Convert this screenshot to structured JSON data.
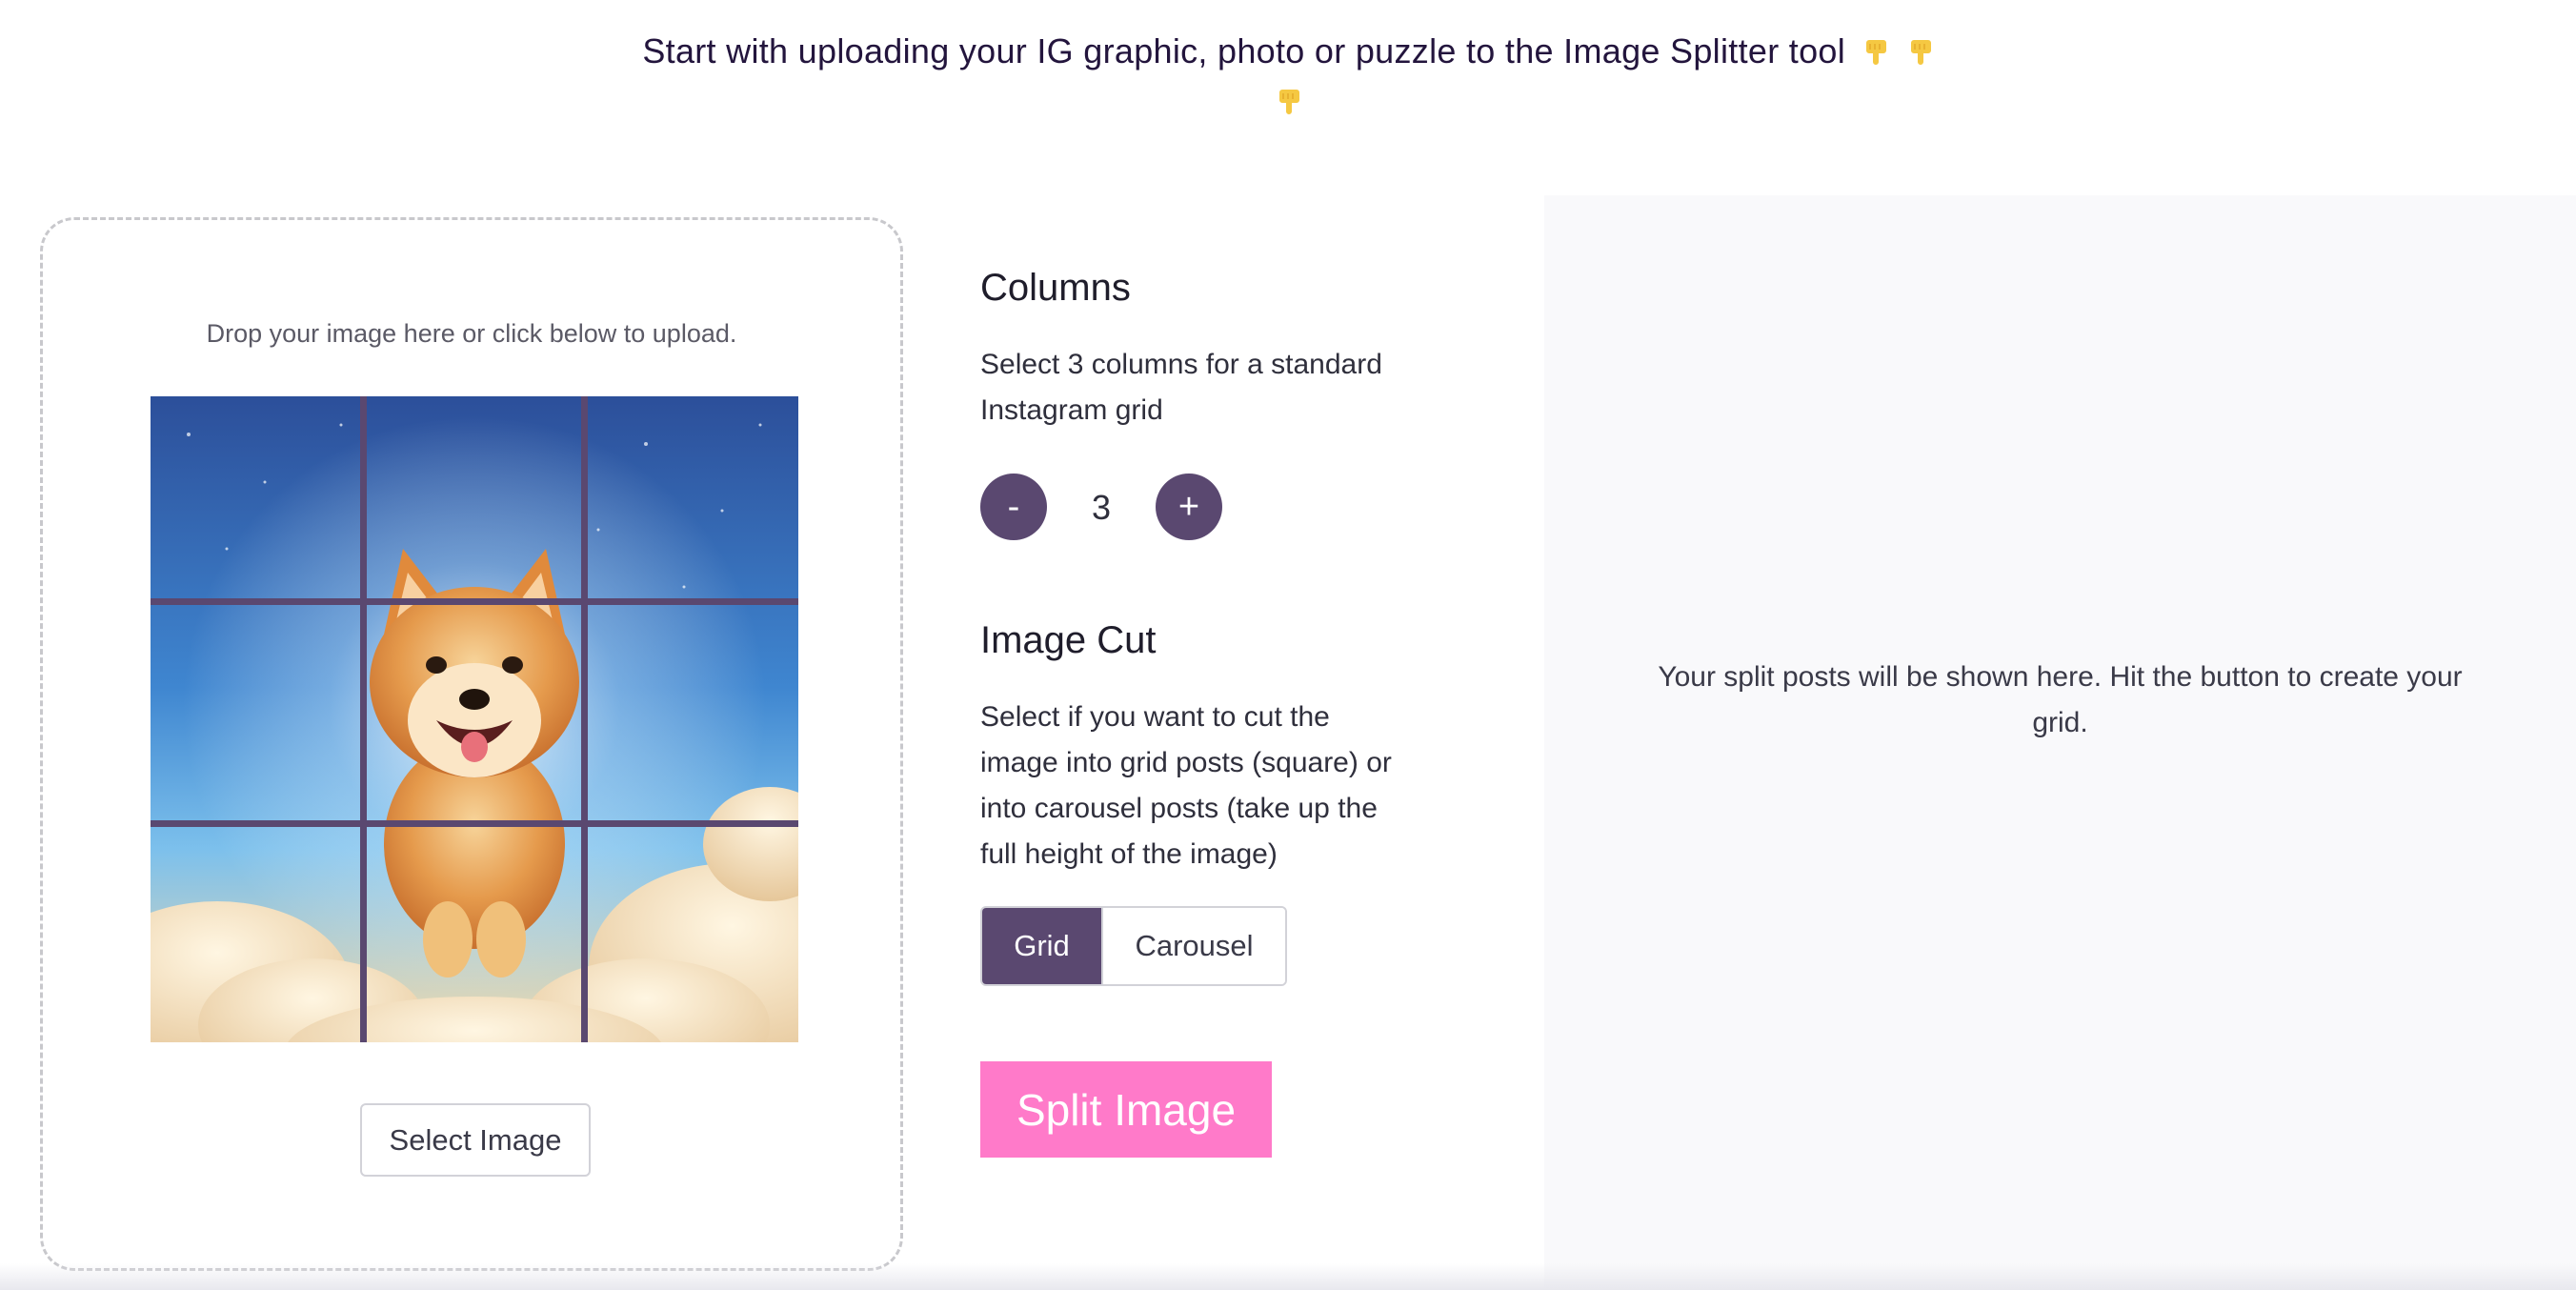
{
  "header": {
    "intro_text": "Start with uploading your IG graphic, photo or puzzle to the Image Splitter tool",
    "emoji_icon": "pointing-down-hand"
  },
  "uploader": {
    "hint": "Drop your image here or click below to upload.",
    "preview_icon": "shiba-dog-in-clouds",
    "grid_columns": 3,
    "grid_rows": 3,
    "select_button": "Select Image"
  },
  "columns": {
    "title": "Columns",
    "description": "Select 3 columns for a standard Instagram grid",
    "decrement_label": "-",
    "value": "3",
    "increment_label": "+"
  },
  "image_cut": {
    "title": "Image Cut",
    "description": "Select if you want to cut the image into grid posts (square) or into carousel posts (take up the full height of the image)",
    "options": [
      "Grid",
      "Carousel"
    ],
    "selected": "Grid"
  },
  "actions": {
    "split_button": "Split Image"
  },
  "results": {
    "placeholder": "Your split posts will be shown here. Hit the button to create your grid."
  },
  "colors": {
    "accent": "#5a4870",
    "split_button": "#ff7ac9",
    "emoji": "#f5c842",
    "header_text": "#23153d",
    "panel_bg": "#f9f9fb"
  }
}
